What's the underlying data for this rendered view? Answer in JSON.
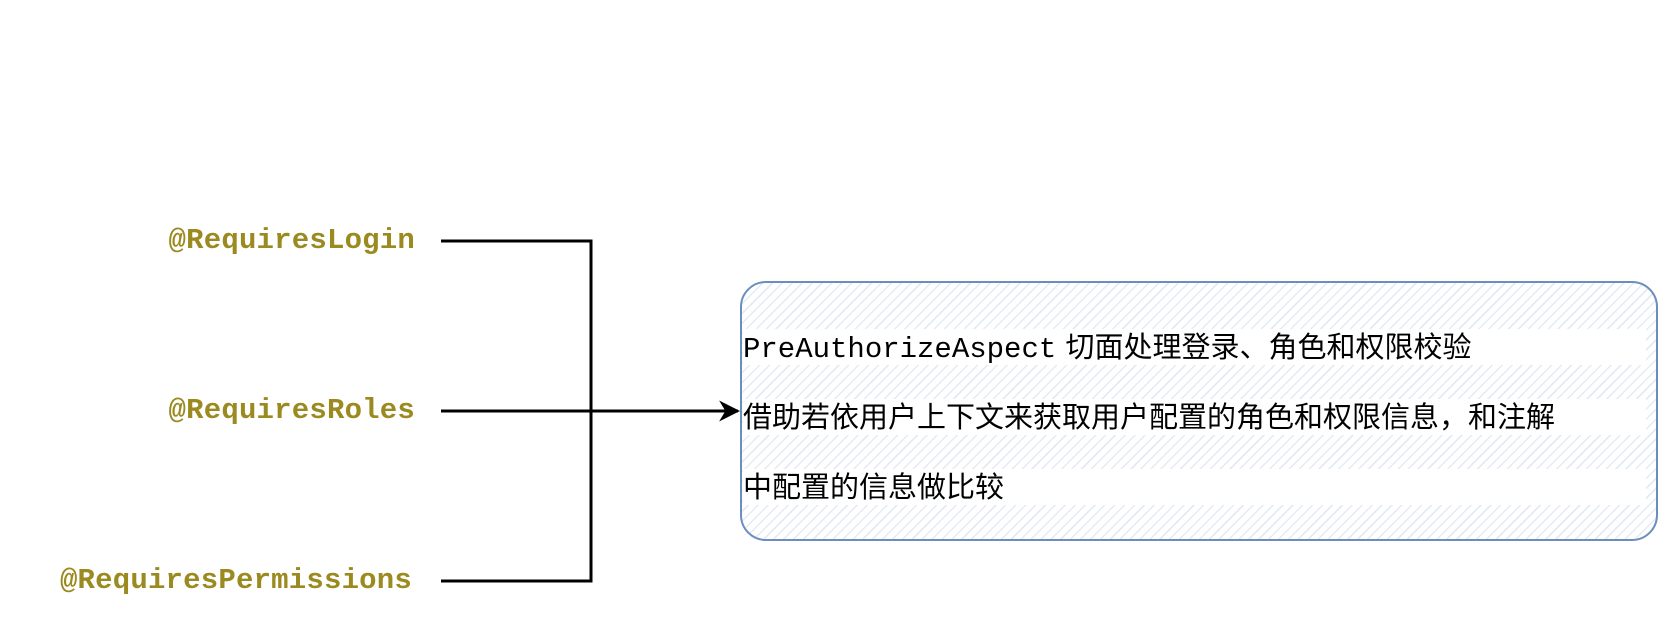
{
  "annotations": {
    "login": "@RequiresLogin",
    "roles": "@RequiresRoles",
    "permissions": "@RequiresPermissions"
  },
  "note": {
    "line1_class": "PreAuthorizeAspect",
    "line1_text": " 切面处理登录、角色和权限校验",
    "line2": "借助若依用户上下文来获取用户配置的角色和权限信息，和注解",
    "line3": "中配置的信息做比较"
  },
  "colors": {
    "annotation_text": "#9a8a1f",
    "box_border": "#6c8ebf",
    "hatch": "#6c8ebf",
    "connector": "#000000"
  }
}
